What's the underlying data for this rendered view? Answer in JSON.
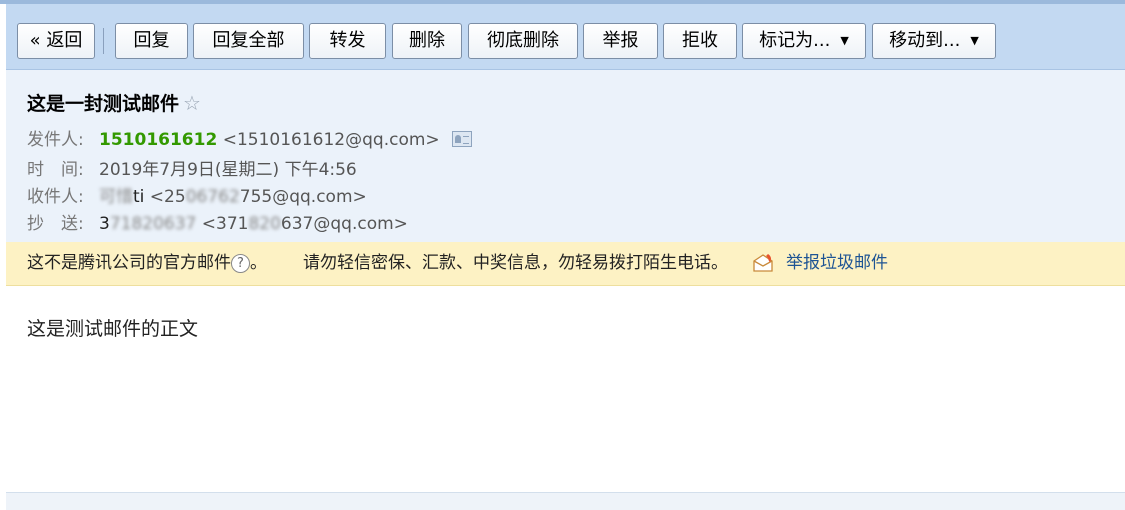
{
  "toolbar": {
    "back": "« 返回",
    "reply": "回复",
    "reply_all": "回复全部",
    "forward": "转发",
    "delete": "删除",
    "delete_permanently": "彻底删除",
    "report": "举报",
    "reject": "拒收",
    "mark_as": "标记为...",
    "move_to": "移动到..."
  },
  "mail": {
    "subject": "这是一封测试邮件",
    "star_icon": "☆",
    "from_label": "发件人:",
    "from_name": "1510161612",
    "from_email": "<1510161612@qq.com>",
    "time_label": "时　间:",
    "time_value": "2019年7月9日(星期二) 下午4:56",
    "to_label": "收件人:",
    "to_name_blurred": "可惜",
    "to_name_visible": "ti",
    "to_email_pre": "<25",
    "to_email_blurred": "06762",
    "to_email_post": "755@qq.com>",
    "cc_label": "抄　送:",
    "cc_name_visible": "3",
    "cc_name_blurred": "71820637",
    "cc_email_pre": "<371",
    "cc_email_blurred": "820",
    "cc_email_post": "637@qq.com>",
    "body": "这是测试邮件的正文"
  },
  "warning": {
    "text": "这不是腾讯公司的官方邮件",
    "help_icon": "?",
    "period": "。",
    "tip": "请勿轻信密保、汇款、中奖信息，勿轻易拨打陌生电话。",
    "report_link": "举报垃圾邮件"
  }
}
